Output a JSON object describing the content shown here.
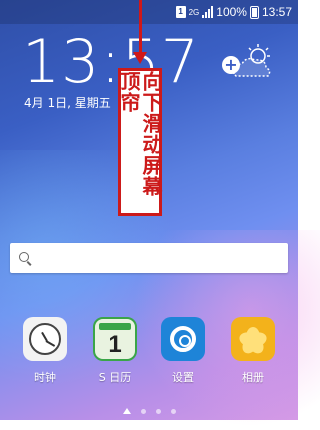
{
  "status_bar": {
    "sim_label": "1",
    "network_label": "2G",
    "battery_percent": "100%",
    "time": "13:57"
  },
  "lockscreen": {
    "clock": "13:57",
    "date": "4月 1日, 星期五"
  },
  "annotation": {
    "text": "向下滑动屏幕顶帘",
    "color": "#cc1a1a"
  },
  "search": {
    "placeholder": ""
  },
  "dock": [
    {
      "label": "时钟",
      "icon": "clock-icon"
    },
    {
      "label": "S 日历",
      "icon": "calendar-icon",
      "day": "1"
    },
    {
      "label": "设置",
      "icon": "settings-icon"
    },
    {
      "label": "相册",
      "icon": "gallery-icon"
    }
  ]
}
